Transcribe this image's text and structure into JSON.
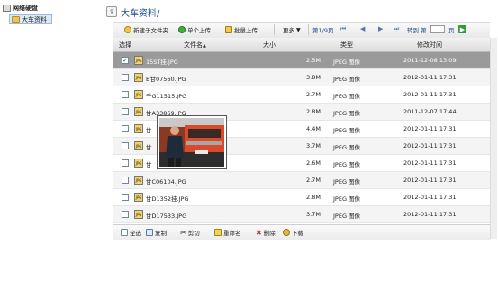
{
  "tree": {
    "root": "网络硬盘",
    "child": "大车资料"
  },
  "main": {
    "title": "大车资料/"
  },
  "toolbar": {
    "new_folder": "新建子文件夹",
    "upload_single": "单个上传",
    "upload_batch": "批量上传",
    "more": "更多"
  },
  "pager": {
    "page": "第1/9页",
    "goto": "转到 第",
    "page_suffix": "页"
  },
  "table": {
    "headers": [
      "选择",
      "文件名",
      "大小",
      "类型",
      "修改时间"
    ],
    "rows": [
      {
        "checked": "✓",
        "name": "15ST挂.JPG",
        "size": "2.5M",
        "type": "JPEG 图像",
        "time": "2011-12-08 13:09"
      },
      {
        "checked": "",
        "name": "B甘07560.JPG",
        "size": "3.8M",
        "type": "JPEG 图像",
        "time": "2012-01-11 17:31"
      },
      {
        "checked": "",
        "name": "千G11515.JPG",
        "size": "2.7M",
        "type": "JPEG 图像",
        "time": "2012-01-11 17:31"
      },
      {
        "checked": "",
        "name": "甘A33869.JPG",
        "size": "2.8M",
        "type": "JPEG 图像",
        "time": "2011-12-07 17:44"
      },
      {
        "checked": "",
        "name": "甘",
        "size": "4.4M",
        "type": "JPEG 图像",
        "time": "2012-01-11 17:31"
      },
      {
        "checked": "",
        "name": "甘",
        "size": "3.7M",
        "type": "JPEG 图像",
        "time": "2012-01-11 17:31"
      },
      {
        "checked": "",
        "name": "甘",
        "size": "2.6M",
        "type": "JPEG 图像",
        "time": "2012-01-11 17:31"
      },
      {
        "checked": "",
        "name": "甘C06104.JPG",
        "size": "2.7M",
        "type": "JPEG 图像",
        "time": "2012-01-11 17:31"
      },
      {
        "checked": "",
        "name": "甘D1352挂.JPG",
        "size": "2.8M",
        "type": "JPEG 图像",
        "time": "2012-01-11 17:31"
      },
      {
        "checked": "",
        "name": "甘D17533.JPG",
        "size": "3.7M",
        "type": "JPEG 图像",
        "time": "2012-01-11 17:31"
      }
    ]
  },
  "bottom": {
    "select_all": "全选",
    "copy": "复制",
    "cut": "剪切",
    "rename": "重命名",
    "delete": "删除",
    "download": "下载"
  },
  "icon_text": "JPG"
}
